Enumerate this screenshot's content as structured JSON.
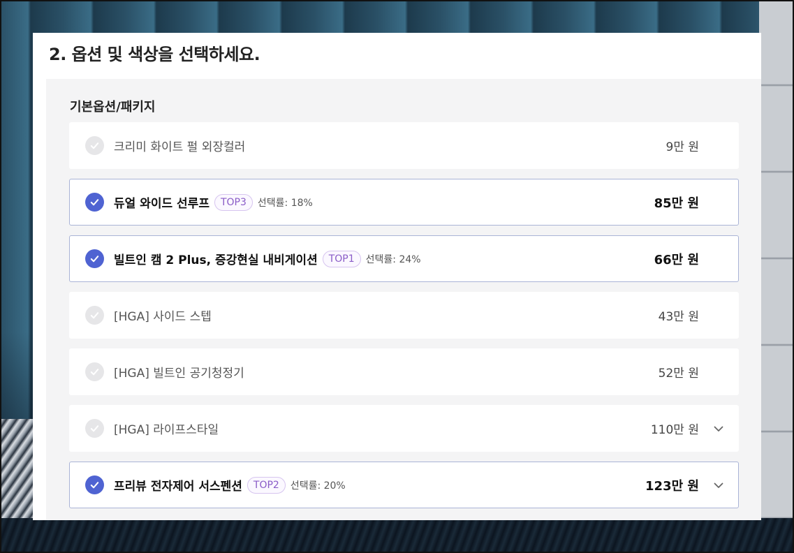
{
  "section": {
    "title": "2. 옵션 및 색상을 선택하세요."
  },
  "group": {
    "title": "기본옵션/패키지"
  },
  "options": [
    {
      "name": "크리미 화이트 펄 외장컬러",
      "price": "9만 원",
      "selected": false,
      "badge": "",
      "rate": "",
      "expandable": false
    },
    {
      "name": "듀얼 와이드 선루프",
      "price": "85만 원",
      "selected": true,
      "badge": "TOP3",
      "rate": "선택률: 18%",
      "expandable": false
    },
    {
      "name": "빌트인 캠 2 Plus, 증강현실 내비게이션",
      "price": "66만 원",
      "selected": true,
      "badge": "TOP1",
      "rate": "선택률: 24%",
      "expandable": false
    },
    {
      "name": "[HGA] 사이드 스텝",
      "price": "43만 원",
      "selected": false,
      "badge": "",
      "rate": "",
      "expandable": false
    },
    {
      "name": "[HGA] 빌트인 공기청정기",
      "price": "52만 원",
      "selected": false,
      "badge": "",
      "rate": "",
      "expandable": false
    },
    {
      "name": "[HGA] 라이프스타일",
      "price": "110만 원",
      "selected": false,
      "badge": "",
      "rate": "",
      "expandable": true
    },
    {
      "name": "프리뷰 전자제어 서스펜션",
      "price": "123만 원",
      "selected": true,
      "badge": "TOP2",
      "rate": "선택률: 20%",
      "expandable": true
    }
  ],
  "icons": {
    "check": "check-icon",
    "expand": "chevron-down-icon"
  },
  "colors": {
    "accent": "#4f63d2",
    "badge_text": "#8a5cc7",
    "selected_border": "#a9b3d6"
  }
}
